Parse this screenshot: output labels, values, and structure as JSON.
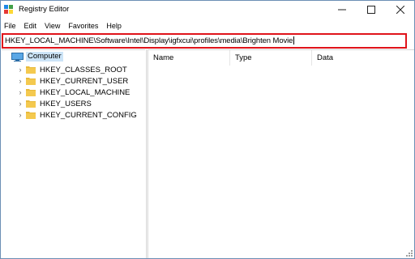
{
  "window": {
    "title": "Registry Editor",
    "controls": {
      "minimize": "—",
      "maximize": "☐",
      "close": "✕"
    }
  },
  "menu": {
    "items": [
      "File",
      "Edit",
      "View",
      "Favorites",
      "Help"
    ]
  },
  "address": {
    "path": "HKEY_LOCAL_MACHINE\\Software\\Intel\\Display\\igfxcui\\profiles\\media\\Brighten Movie",
    "highlight_color": "#e0131a"
  },
  "tree": {
    "root": {
      "label": "Computer",
      "icon": "computer-icon",
      "selected": true
    },
    "items": [
      {
        "label": "HKEY_CLASSES_ROOT",
        "icon": "folder-icon"
      },
      {
        "label": "HKEY_CURRENT_USER",
        "icon": "folder-icon"
      },
      {
        "label": "HKEY_LOCAL_MACHINE",
        "icon": "folder-icon"
      },
      {
        "label": "HKEY_USERS",
        "icon": "folder-icon"
      },
      {
        "label": "HKEY_CURRENT_CONFIG",
        "icon": "folder-icon"
      }
    ],
    "expand_glyph": "›"
  },
  "list": {
    "columns": [
      "Name",
      "Type",
      "Data"
    ],
    "rows": []
  },
  "colors": {
    "folder": "#e8b93a",
    "selection": "#cce4f7",
    "accent": "#0078d7"
  }
}
